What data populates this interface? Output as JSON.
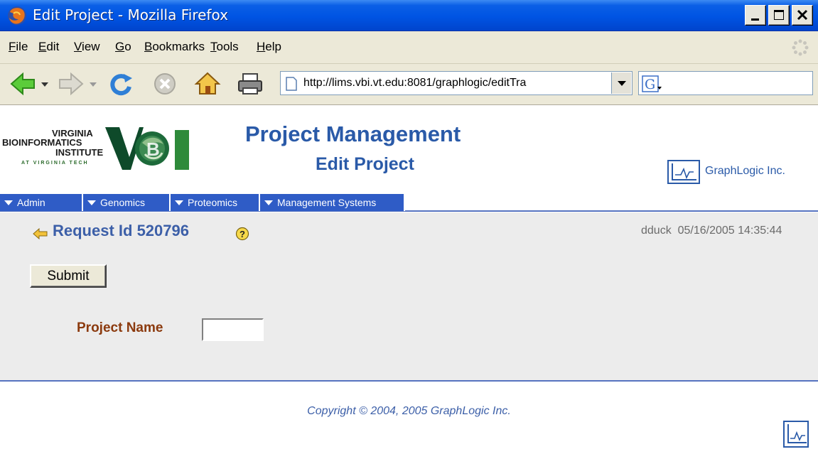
{
  "window": {
    "title": "Edit Project - Mozilla Firefox",
    "icon": "firefox-icon"
  },
  "menubar": {
    "items": [
      {
        "label": "File",
        "mnemonic": "F"
      },
      {
        "label": "Edit",
        "mnemonic": "E"
      },
      {
        "label": "View",
        "mnemonic": "V"
      },
      {
        "label": "Go",
        "mnemonic": "G"
      },
      {
        "label": "Bookmarks",
        "mnemonic": "B"
      },
      {
        "label": "Tools",
        "mnemonic": "T"
      },
      {
        "label": "Help",
        "mnemonic": "H"
      }
    ]
  },
  "navbar": {
    "buttons": [
      "back-icon",
      "forward-icon",
      "reload-icon",
      "stop-icon",
      "home-icon",
      "print-icon"
    ],
    "url": "http://lims.vbi.vt.edu:8081/graphlogic/editTra",
    "search_value": ""
  },
  "header": {
    "logo_lines": [
      "VIRGINIA",
      "BIOINFORMATICS",
      "INSTITUTE",
      "AT VIRGINIA TECH"
    ],
    "logo_mark": "VBI",
    "title": "Project Management",
    "subtitle": "Edit Project",
    "company": "GraphLogic Inc."
  },
  "appnav": {
    "items": [
      "Admin",
      "Genomics",
      "Proteomics",
      "Management Systems"
    ]
  },
  "main": {
    "request_label": "Request Id 520796",
    "user": "dduck",
    "timestamp": "05/16/2005 14:35:44",
    "submit_label": "Submit",
    "field_label": "Project Name",
    "field_value": ""
  },
  "footer": {
    "copyright": "Copyright © 2004, 2005 GraphLogic Inc."
  },
  "colors": {
    "accent": "#2a5aa8",
    "nav_blue": "#2f5cc6",
    "label_brown": "#8b3a0e",
    "content_bg": "#ececec"
  }
}
